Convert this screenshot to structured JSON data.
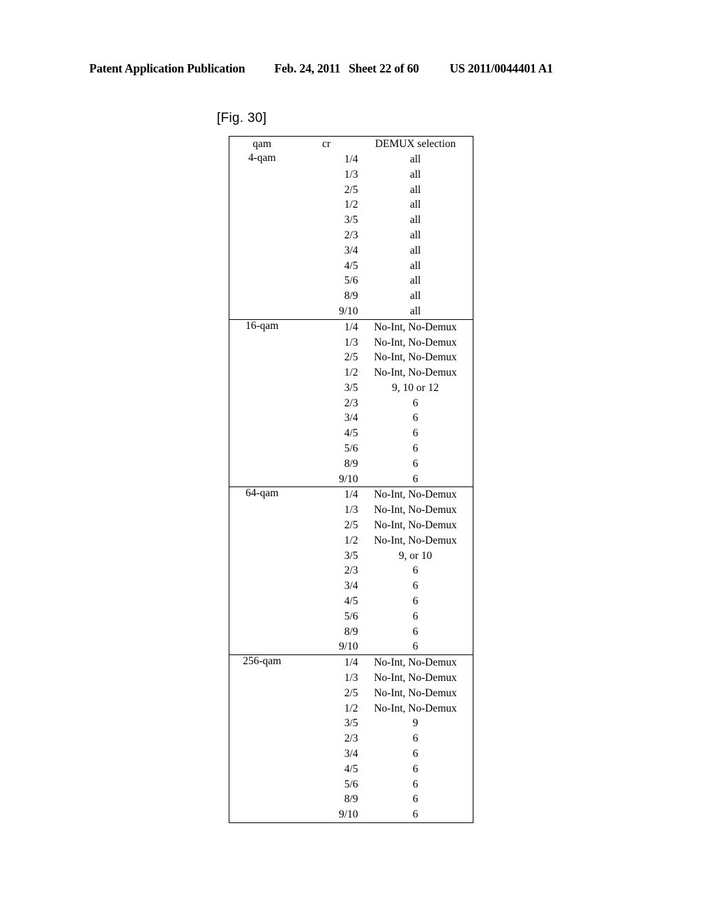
{
  "page_header": {
    "publication": "Patent Application Publication",
    "date": "Feb. 24, 2011",
    "sheet": "Sheet 22 of 60",
    "document_number": "US 2011/0044401 A1"
  },
  "figure": {
    "label": "[Fig. 30]"
  },
  "table": {
    "columns": [
      "qam",
      "cr",
      "DEMUX selection"
    ],
    "blocks": [
      {
        "qam": "4-qam",
        "rows": [
          {
            "cr": "1/4",
            "demux": "all"
          },
          {
            "cr": "1/3",
            "demux": "all"
          },
          {
            "cr": "2/5",
            "demux": "all"
          },
          {
            "cr": "1/2",
            "demux": "all"
          },
          {
            "cr": "3/5",
            "demux": "all"
          },
          {
            "cr": "2/3",
            "demux": "all"
          },
          {
            "cr": "3/4",
            "demux": "all"
          },
          {
            "cr": "4/5",
            "demux": "all"
          },
          {
            "cr": "5/6",
            "demux": "all"
          },
          {
            "cr": "8/9",
            "demux": "all"
          },
          {
            "cr": "9/10",
            "demux": "all"
          }
        ]
      },
      {
        "qam": "16-qam",
        "rows": [
          {
            "cr": "1/4",
            "demux": "No-Int, No-Demux"
          },
          {
            "cr": "1/3",
            "demux": "No-Int, No-Demux"
          },
          {
            "cr": "2/5",
            "demux": "No-Int, No-Demux"
          },
          {
            "cr": "1/2",
            "demux": "No-Int, No-Demux"
          },
          {
            "cr": "3/5",
            "demux": "9, 10 or 12"
          },
          {
            "cr": "2/3",
            "demux": "6"
          },
          {
            "cr": "3/4",
            "demux": "6"
          },
          {
            "cr": "4/5",
            "demux": "6"
          },
          {
            "cr": "5/6",
            "demux": "6"
          },
          {
            "cr": "8/9",
            "demux": "6"
          },
          {
            "cr": "9/10",
            "demux": "6"
          }
        ]
      },
      {
        "qam": "64-qam",
        "rows": [
          {
            "cr": "1/4",
            "demux": "No-Int, No-Demux"
          },
          {
            "cr": "1/3",
            "demux": "No-Int, No-Demux"
          },
          {
            "cr": "2/5",
            "demux": "No-Int, No-Demux"
          },
          {
            "cr": "1/2",
            "demux": "No-Int, No-Demux"
          },
          {
            "cr": "3/5",
            "demux": "9, or 10"
          },
          {
            "cr": "2/3",
            "demux": "6"
          },
          {
            "cr": "3/4",
            "demux": "6"
          },
          {
            "cr": "4/5",
            "demux": "6"
          },
          {
            "cr": "5/6",
            "demux": "6"
          },
          {
            "cr": "8/9",
            "demux": "6"
          },
          {
            "cr": "9/10",
            "demux": "6"
          }
        ]
      },
      {
        "qam": "256-qam",
        "rows": [
          {
            "cr": "1/4",
            "demux": "No-Int, No-Demux"
          },
          {
            "cr": "1/3",
            "demux": "No-Int, No-Demux"
          },
          {
            "cr": "2/5",
            "demux": "No-Int, No-Demux"
          },
          {
            "cr": "1/2",
            "demux": "No-Int, No-Demux"
          },
          {
            "cr": "3/5",
            "demux": "9"
          },
          {
            "cr": "2/3",
            "demux": "6"
          },
          {
            "cr": "3/4",
            "demux": "6"
          },
          {
            "cr": "4/5",
            "demux": "6"
          },
          {
            "cr": "5/6",
            "demux": "6"
          },
          {
            "cr": "8/9",
            "demux": "6"
          },
          {
            "cr": "9/10",
            "demux": "6"
          }
        ]
      }
    ]
  }
}
